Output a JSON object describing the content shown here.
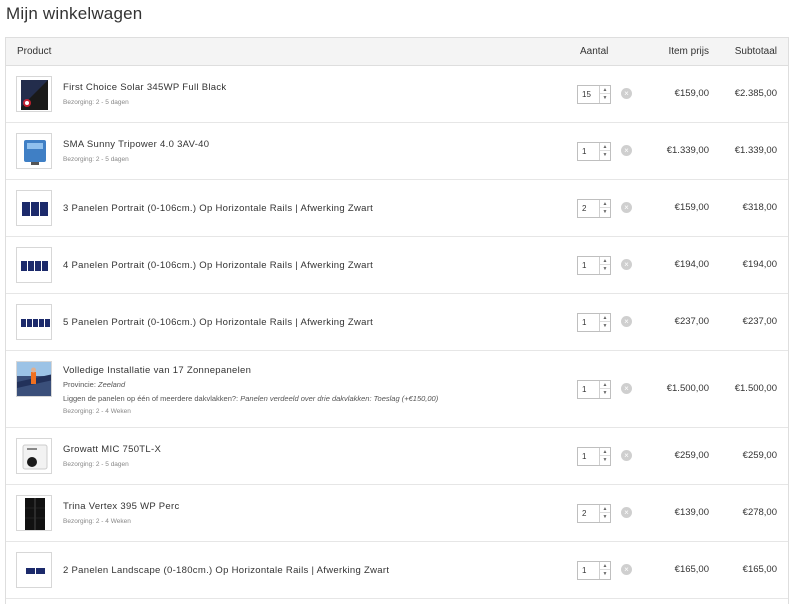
{
  "page": {
    "title": "Mijn winkelwagen"
  },
  "colors": {
    "border": "#dedede",
    "header_bg": "#f4f4f4",
    "remove_icon": "#cfcfcf"
  },
  "table": {
    "headers": {
      "product": "Product",
      "qty": "Aantal",
      "price": "Item prijs",
      "subtotal": "Subtotaal"
    },
    "items": [
      {
        "name": "First Choice Solar 345WP Full Black",
        "delivery": "Bezorging: 2 - 5 dagen",
        "qty": "15",
        "price": "€159,00",
        "subtotal": "€2.385,00",
        "thumb_icon": "solar-panel-black-icon"
      },
      {
        "name": "SMA Sunny Tripower 4.0 3AV-40",
        "delivery": "Bezorging: 2 - 5 dagen",
        "qty": "1",
        "price": "€1.339,00",
        "subtotal": "€1.339,00",
        "thumb_icon": "inverter-icon"
      },
      {
        "name": "3 Panelen Portrait (0-106cm.) Op Horizontale Rails | Afwerking Zwart",
        "qty": "2",
        "price": "€159,00",
        "subtotal": "€318,00",
        "thumb_icon": "mounting-3-panels-icon"
      },
      {
        "name": "4 Panelen Portrait (0-106cm.) Op Horizontale Rails | Afwerking Zwart",
        "qty": "1",
        "price": "€194,00",
        "subtotal": "€194,00",
        "thumb_icon": "mounting-4-panels-icon"
      },
      {
        "name": "5 Panelen Portrait (0-106cm.) Op Horizontale Rails | Afwerking Zwart",
        "qty": "1",
        "price": "€237,00",
        "subtotal": "€237,00",
        "thumb_icon": "mounting-5-panels-icon"
      },
      {
        "name": "Volledige Installatie van 17 Zonnepanelen",
        "option1_label": "Provincie:",
        "option1_value": "Zeeland",
        "option2_label": "Liggen de panelen op één of meerdere dakvlakken?:",
        "option2_value": "Panelen verdeeld over drie dakvlakken: Toeslag (+€150,00)",
        "delivery": "Bezorging: 2 - 4 Weken",
        "qty": "1",
        "price": "€1.500,00",
        "subtotal": "€1.500,00",
        "thumb_icon": "installation-photo-icon"
      },
      {
        "name": "Growatt MIC 750TL-X",
        "delivery": "Bezorging: 2 - 5 dagen",
        "qty": "1",
        "price": "€259,00",
        "subtotal": "€259,00",
        "thumb_icon": "growatt-inverter-icon"
      },
      {
        "name": "Trina Vertex 395 WP Perc",
        "delivery": "Bezorging: 2 - 4 Weken",
        "qty": "2",
        "price": "€139,00",
        "subtotal": "€278,00",
        "thumb_icon": "solar-panel-icon"
      },
      {
        "name": "2 Panelen Landscape (0-180cm.) Op Horizontale Rails | Afwerking Zwart",
        "qty": "1",
        "price": "€165,00",
        "subtotal": "€165,00",
        "thumb_icon": "mounting-landscape-icon"
      }
    ]
  }
}
